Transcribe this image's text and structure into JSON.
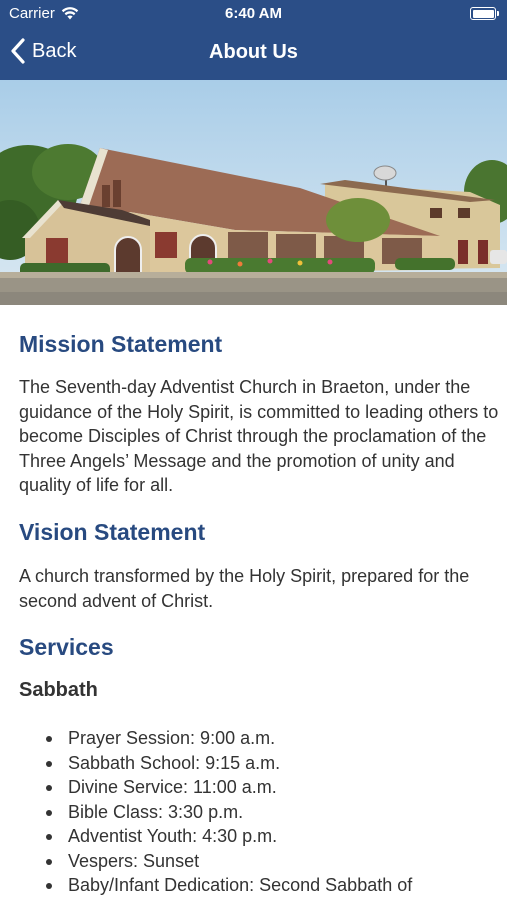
{
  "status_bar": {
    "carrier": "Carrier",
    "time": "6:40 AM"
  },
  "navbar": {
    "back_label": "Back",
    "title": "About Us"
  },
  "colors": {
    "nav_background": "#2b4e87",
    "heading": "#284a80",
    "body_text": "#333333"
  },
  "mission": {
    "title": "Mission Statement",
    "text": "The Seventh-day Adventist Church in Braeton, under the guidance of the Holy Spirit, is committed to leading others to become Disciples of Christ through the proclamation of the Three Angels’ Message and the promotion of unity and quality of life for all."
  },
  "vision": {
    "title": "Vision Statement",
    "text": "A church transformed by the Holy Spirit, prepared for the second advent of Christ."
  },
  "services": {
    "title": "Services",
    "sabbath_title": "Sabbath",
    "items": [
      "Prayer Session: 9:00 a.m.",
      "Sabbath School: 9:15 a.m.",
      "Divine Service: 11:00 a.m.",
      "Bible Class: 3:30 p.m.",
      "Adventist Youth: 4:30 p.m.",
      "Vespers: Sunset",
      "Baby/Infant Dedication: Second Sabbath of"
    ]
  }
}
